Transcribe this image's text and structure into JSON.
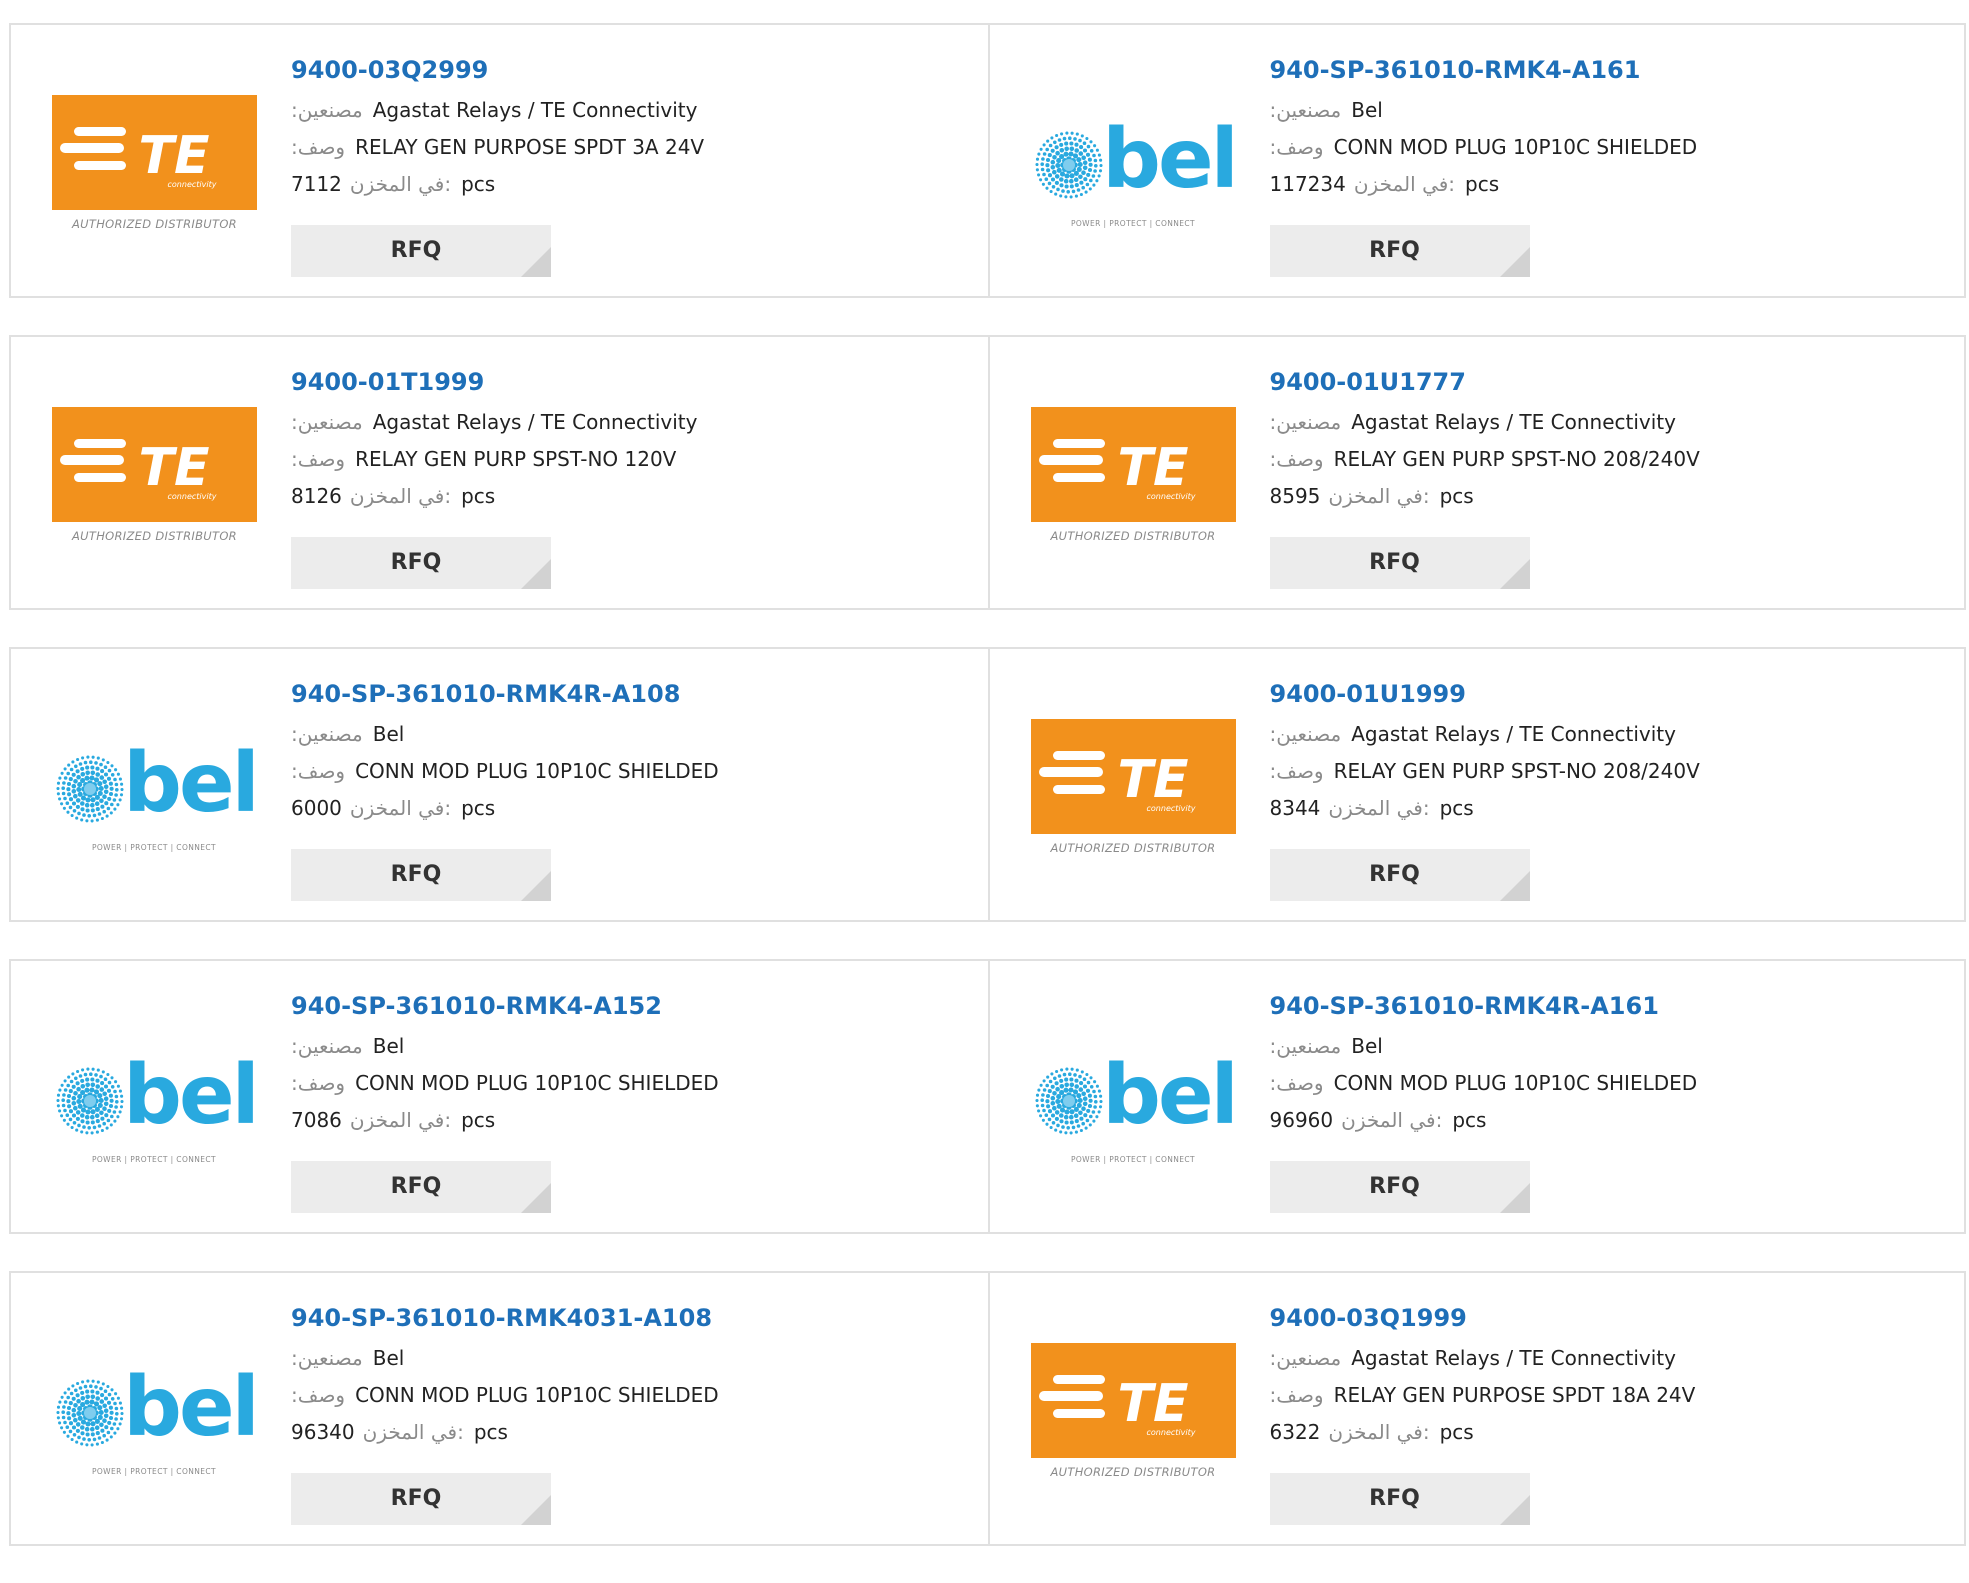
{
  "labels": {
    "manufacturer": ":مصنعين",
    "description": ":وصف",
    "stock": "في المخزن:",
    "rfq": "RFQ",
    "unit": "pcs"
  },
  "brand_colors": {
    "te_orange": "#f2911c",
    "bel_blue": "#29a9df",
    "link_blue": "#1e6fb8"
  },
  "logos": {
    "te": {
      "wordmark": "TE",
      "sub": "connectivity",
      "tagline": "AUTHORIZED DISTRIBUTOR"
    },
    "bel": {
      "wordmark": "bel",
      "tagline": "POWER | PROTECT | CONNECT"
    }
  },
  "products": [
    {
      "part": "9400-03Q2999",
      "logo": "te",
      "manufacturer": "Agastat Relays / TE Connectivity",
      "description": "RELAY GEN PURPOSE SPDT 3A 24V",
      "stock": "7112"
    },
    {
      "part": "940-SP-361010-RMK4-A161",
      "logo": "bel",
      "manufacturer": "Bel",
      "description": "CONN MOD PLUG 10P10C SHIELDED",
      "stock": "117234"
    },
    {
      "part": "9400-01T1999",
      "logo": "te",
      "manufacturer": "Agastat Relays / TE Connectivity",
      "description": "RELAY GEN PURP SPST-NO 120V",
      "stock": "8126"
    },
    {
      "part": "9400-01U1777",
      "logo": "te",
      "manufacturer": "Agastat Relays / TE Connectivity",
      "description": "RELAY GEN PURP SPST-NO 208/240V",
      "stock": "8595"
    },
    {
      "part": "940-SP-361010-RMK4R-A108",
      "logo": "bel",
      "manufacturer": "Bel",
      "description": "CONN MOD PLUG 10P10C SHIELDED",
      "stock": "6000"
    },
    {
      "part": "9400-01U1999",
      "logo": "te",
      "manufacturer": "Agastat Relays / TE Connectivity",
      "description": "RELAY GEN PURP SPST-NO 208/240V",
      "stock": "8344"
    },
    {
      "part": "940-SP-361010-RMK4-A152",
      "logo": "bel",
      "manufacturer": "Bel",
      "description": "CONN MOD PLUG 10P10C SHIELDED",
      "stock": "7086"
    },
    {
      "part": "940-SP-361010-RMK4R-A161",
      "logo": "bel",
      "manufacturer": "Bel",
      "description": "CONN MOD PLUG 10P10C SHIELDED",
      "stock": "96960"
    },
    {
      "part": "940-SP-361010-RMK4031-A108",
      "logo": "bel",
      "manufacturer": "Bel",
      "description": "CONN MOD PLUG 10P10C SHIELDED",
      "stock": "96340"
    },
    {
      "part": "9400-03Q1999",
      "logo": "te",
      "manufacturer": "Agastat Relays / TE Connectivity",
      "description": "RELAY GEN PURPOSE SPDT 18A 24V",
      "stock": "6322"
    }
  ]
}
